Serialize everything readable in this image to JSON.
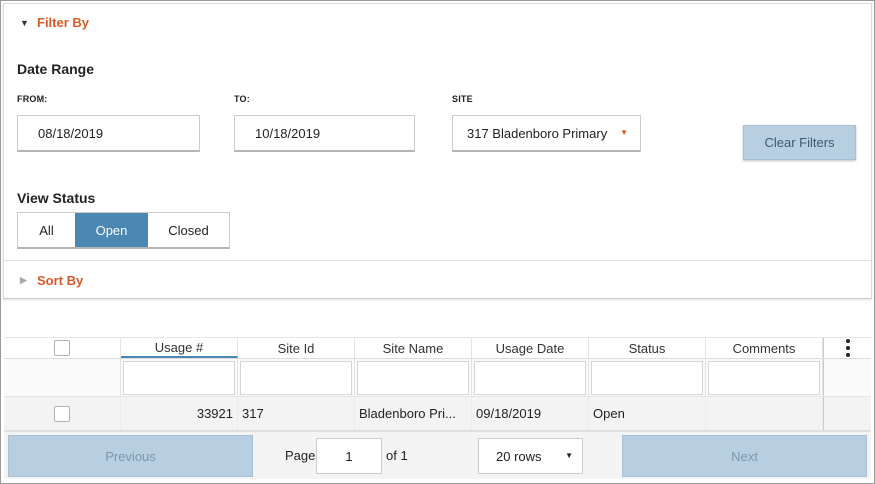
{
  "filter": {
    "title": "Filter By",
    "date_range_label": "Date Range",
    "from_label": "FROM:",
    "from_value": "08/18/2019",
    "to_label": "TO:",
    "to_value": "10/18/2019",
    "site_label": "SITE",
    "site_value": "317 Bladenboro Primary",
    "clear_label": "Clear Filters",
    "view_status_label": "View Status",
    "status_options": [
      "All",
      "Open",
      "Closed"
    ],
    "status_selected": "Open"
  },
  "sort": {
    "title": "Sort By"
  },
  "grid": {
    "columns": [
      "Usage #",
      "Site Id",
      "Site Name",
      "Usage Date",
      "Status",
      "Comments"
    ],
    "rows": [
      {
        "usage": "33921",
        "site_id": "317",
        "site_name": "Bladenboro Pri...",
        "usage_date": "09/18/2019",
        "status": "Open",
        "comments": ""
      }
    ]
  },
  "pager": {
    "previous_label": "Previous",
    "page_label": "Page",
    "page_value": "1",
    "of_label": "of 1",
    "rows_value": "20 rows",
    "next_label": "Next"
  },
  "colors": {
    "accent": "#d55b28",
    "selected": "#4a87b2",
    "button": "#b7cfe0"
  },
  "icons": {
    "expand": "caret-down-icon",
    "collapsed": "caret-right-icon",
    "dropdown": "dropdown-arrow-icon",
    "menu": "kebab-menu-icon"
  }
}
